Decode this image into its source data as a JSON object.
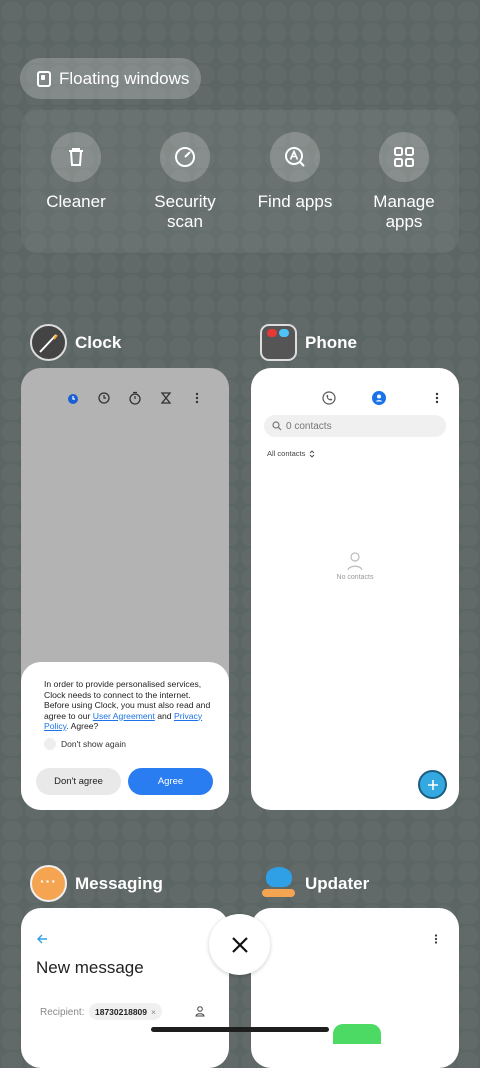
{
  "floating_windows": {
    "label": "Floating windows"
  },
  "tools": [
    {
      "label": "Cleaner",
      "icon": "trash-icon"
    },
    {
      "label": "Security\nscan",
      "icon": "speedometer-icon"
    },
    {
      "label": "Find apps",
      "icon": "search-app-icon"
    },
    {
      "label": "Manage\napps",
      "icon": "grid-icon"
    }
  ],
  "apps": {
    "clock": {
      "name": "Clock",
      "consent": {
        "text_before": "In order to provide personalised services, Clock needs to connect to the internet. Before using Clock, you must also read and agree to our ",
        "link1": "User Agreement",
        "text_mid": " and ",
        "link2": "Privacy Policy",
        "text_after": ". Agree?",
        "checkbox_label": "Don't show again",
        "decline": "Don't agree",
        "accept": "Agree"
      }
    },
    "phone": {
      "name": "Phone",
      "search_placeholder": "0 contacts",
      "filter": "All contacts",
      "empty_label": "No contacts"
    },
    "messaging": {
      "name": "Messaging",
      "title": "New message",
      "recipient_label": "Recipient:",
      "recipient_chip": "18730218809"
    },
    "updater": {
      "name": "Updater"
    }
  },
  "colors": {
    "accent": "#2a7df0",
    "phone_fab": "#34a8e0",
    "messaging_icon": "#f5a452"
  }
}
